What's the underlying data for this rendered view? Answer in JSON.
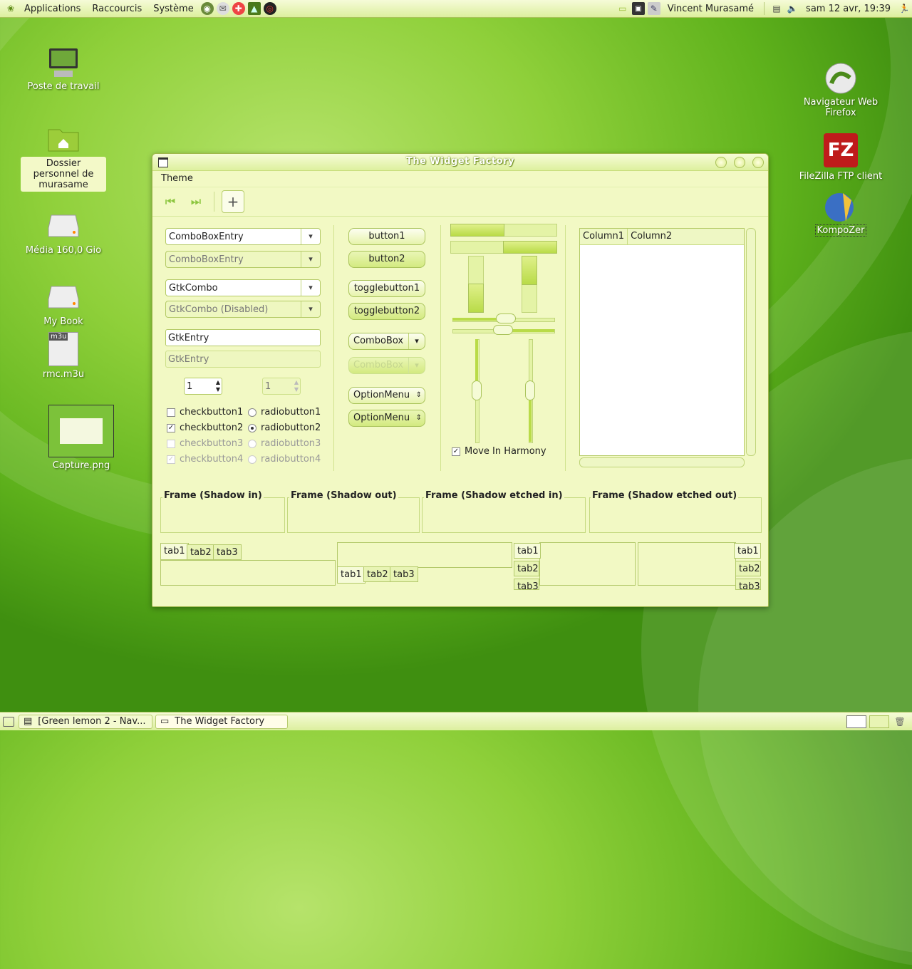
{
  "top_panel": {
    "menus": [
      "Applications",
      "Raccourcis",
      "Système"
    ],
    "user": "Vincent Murasamé",
    "clock": "sam 12 avr, 19:39"
  },
  "desktop": {
    "icons": [
      {
        "label": "Poste de travail"
      },
      {
        "label": "Dossier personnel de murasame"
      },
      {
        "label": "Média 160,0 Gio"
      },
      {
        "label": "My Book"
      },
      {
        "label": "rmc.m3u"
      },
      {
        "label": "Capture.png"
      },
      {
        "label": "Navigateur Web Firefox"
      },
      {
        "label": "FileZilla FTP client"
      },
      {
        "label": "KompoZer"
      }
    ],
    "m3u_badge": "m3u"
  },
  "window": {
    "title": "The Widget Factory",
    "menu": [
      "Theme"
    ],
    "combos": [
      "ComboBoxEntry",
      "ComboBoxEntry",
      "GtkCombo",
      "GtkCombo (Disabled)"
    ],
    "entries": [
      "GtkEntry",
      "GtkEntry"
    ],
    "spin_values": [
      "1",
      "1"
    ],
    "checks": [
      "checkbutton1",
      "checkbutton2",
      "checkbutton3",
      "checkbutton4"
    ],
    "radios": [
      "radiobutton1",
      "radiobutton2",
      "radiobutton3",
      "radiobutton4"
    ],
    "buttons": [
      "button1",
      "button2",
      "togglebutton1",
      "togglebutton2"
    ],
    "combobox": [
      "ComboBox",
      "ComboBox"
    ],
    "optionmenu": [
      "OptionMenu",
      "OptionMenu"
    ],
    "harmony": "Move In Harmony",
    "columns": [
      "Column1",
      "Column2"
    ],
    "frames": [
      "Frame (Shadow in)",
      "Frame (Shadow out)",
      "Frame (Shadow etched in)",
      "Frame (Shadow etched out)"
    ],
    "tabs": [
      "tab1",
      "tab2",
      "tab3"
    ]
  },
  "taskbar": {
    "tasks": [
      "[Green lemon 2 - Nav...",
      "The Widget Factory"
    ]
  }
}
